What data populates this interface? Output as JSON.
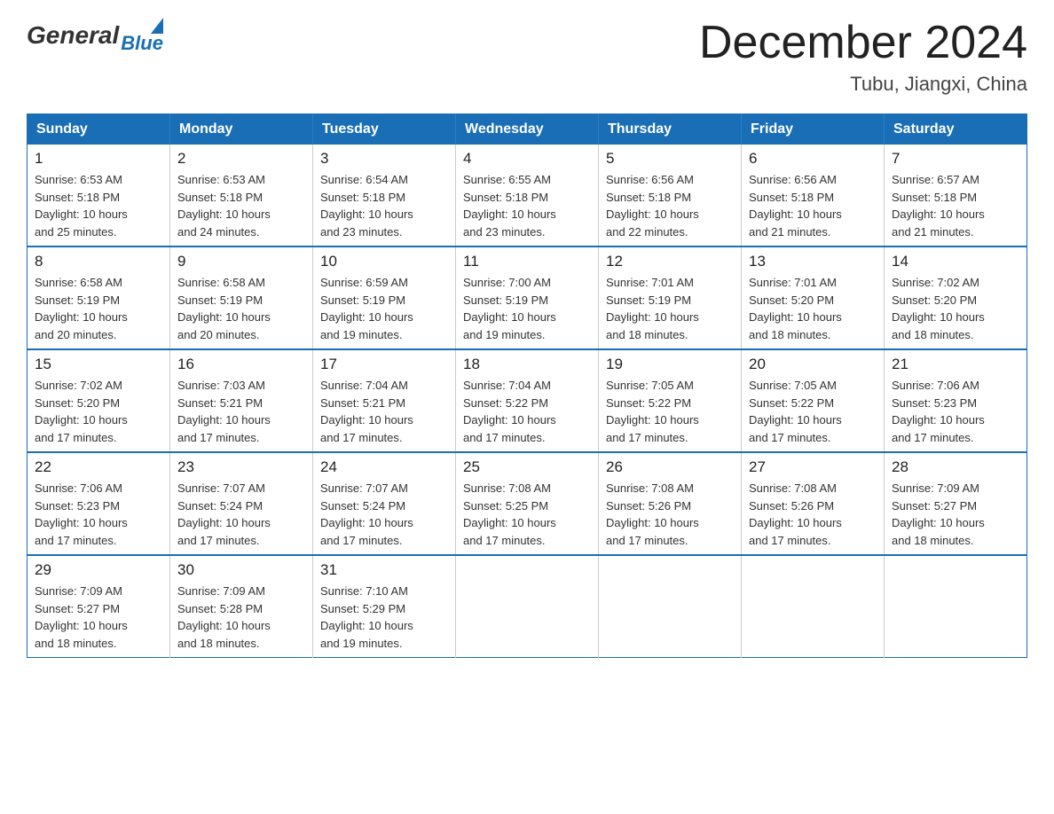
{
  "logo": {
    "general": "General",
    "blue": "Blue"
  },
  "header": {
    "title": "December 2024",
    "subtitle": "Tubu, Jiangxi, China"
  },
  "days_of_week": [
    "Sunday",
    "Monday",
    "Tuesday",
    "Wednesday",
    "Thursday",
    "Friday",
    "Saturday"
  ],
  "weeks": [
    [
      {
        "day": "1",
        "sunrise": "6:53 AM",
        "sunset": "5:18 PM",
        "daylight": "10 hours and 25 minutes."
      },
      {
        "day": "2",
        "sunrise": "6:53 AM",
        "sunset": "5:18 PM",
        "daylight": "10 hours and 24 minutes."
      },
      {
        "day": "3",
        "sunrise": "6:54 AM",
        "sunset": "5:18 PM",
        "daylight": "10 hours and 23 minutes."
      },
      {
        "day": "4",
        "sunrise": "6:55 AM",
        "sunset": "5:18 PM",
        "daylight": "10 hours and 23 minutes."
      },
      {
        "day": "5",
        "sunrise": "6:56 AM",
        "sunset": "5:18 PM",
        "daylight": "10 hours and 22 minutes."
      },
      {
        "day": "6",
        "sunrise": "6:56 AM",
        "sunset": "5:18 PM",
        "daylight": "10 hours and 21 minutes."
      },
      {
        "day": "7",
        "sunrise": "6:57 AM",
        "sunset": "5:18 PM",
        "daylight": "10 hours and 21 minutes."
      }
    ],
    [
      {
        "day": "8",
        "sunrise": "6:58 AM",
        "sunset": "5:19 PM",
        "daylight": "10 hours and 20 minutes."
      },
      {
        "day": "9",
        "sunrise": "6:58 AM",
        "sunset": "5:19 PM",
        "daylight": "10 hours and 20 minutes."
      },
      {
        "day": "10",
        "sunrise": "6:59 AM",
        "sunset": "5:19 PM",
        "daylight": "10 hours and 19 minutes."
      },
      {
        "day": "11",
        "sunrise": "7:00 AM",
        "sunset": "5:19 PM",
        "daylight": "10 hours and 19 minutes."
      },
      {
        "day": "12",
        "sunrise": "7:01 AM",
        "sunset": "5:19 PM",
        "daylight": "10 hours and 18 minutes."
      },
      {
        "day": "13",
        "sunrise": "7:01 AM",
        "sunset": "5:20 PM",
        "daylight": "10 hours and 18 minutes."
      },
      {
        "day": "14",
        "sunrise": "7:02 AM",
        "sunset": "5:20 PM",
        "daylight": "10 hours and 18 minutes."
      }
    ],
    [
      {
        "day": "15",
        "sunrise": "7:02 AM",
        "sunset": "5:20 PM",
        "daylight": "10 hours and 17 minutes."
      },
      {
        "day": "16",
        "sunrise": "7:03 AM",
        "sunset": "5:21 PM",
        "daylight": "10 hours and 17 minutes."
      },
      {
        "day": "17",
        "sunrise": "7:04 AM",
        "sunset": "5:21 PM",
        "daylight": "10 hours and 17 minutes."
      },
      {
        "day": "18",
        "sunrise": "7:04 AM",
        "sunset": "5:22 PM",
        "daylight": "10 hours and 17 minutes."
      },
      {
        "day": "19",
        "sunrise": "7:05 AM",
        "sunset": "5:22 PM",
        "daylight": "10 hours and 17 minutes."
      },
      {
        "day": "20",
        "sunrise": "7:05 AM",
        "sunset": "5:22 PM",
        "daylight": "10 hours and 17 minutes."
      },
      {
        "day": "21",
        "sunrise": "7:06 AM",
        "sunset": "5:23 PM",
        "daylight": "10 hours and 17 minutes."
      }
    ],
    [
      {
        "day": "22",
        "sunrise": "7:06 AM",
        "sunset": "5:23 PM",
        "daylight": "10 hours and 17 minutes."
      },
      {
        "day": "23",
        "sunrise": "7:07 AM",
        "sunset": "5:24 PM",
        "daylight": "10 hours and 17 minutes."
      },
      {
        "day": "24",
        "sunrise": "7:07 AM",
        "sunset": "5:24 PM",
        "daylight": "10 hours and 17 minutes."
      },
      {
        "day": "25",
        "sunrise": "7:08 AM",
        "sunset": "5:25 PM",
        "daylight": "10 hours and 17 minutes."
      },
      {
        "day": "26",
        "sunrise": "7:08 AM",
        "sunset": "5:26 PM",
        "daylight": "10 hours and 17 minutes."
      },
      {
        "day": "27",
        "sunrise": "7:08 AM",
        "sunset": "5:26 PM",
        "daylight": "10 hours and 17 minutes."
      },
      {
        "day": "28",
        "sunrise": "7:09 AM",
        "sunset": "5:27 PM",
        "daylight": "10 hours and 18 minutes."
      }
    ],
    [
      {
        "day": "29",
        "sunrise": "7:09 AM",
        "sunset": "5:27 PM",
        "daylight": "10 hours and 18 minutes."
      },
      {
        "day": "30",
        "sunrise": "7:09 AM",
        "sunset": "5:28 PM",
        "daylight": "10 hours and 18 minutes."
      },
      {
        "day": "31",
        "sunrise": "7:10 AM",
        "sunset": "5:29 PM",
        "daylight": "10 hours and 19 minutes."
      },
      null,
      null,
      null,
      null
    ]
  ],
  "labels": {
    "sunrise": "Sunrise:",
    "sunset": "Sunset:",
    "daylight": "Daylight:"
  }
}
